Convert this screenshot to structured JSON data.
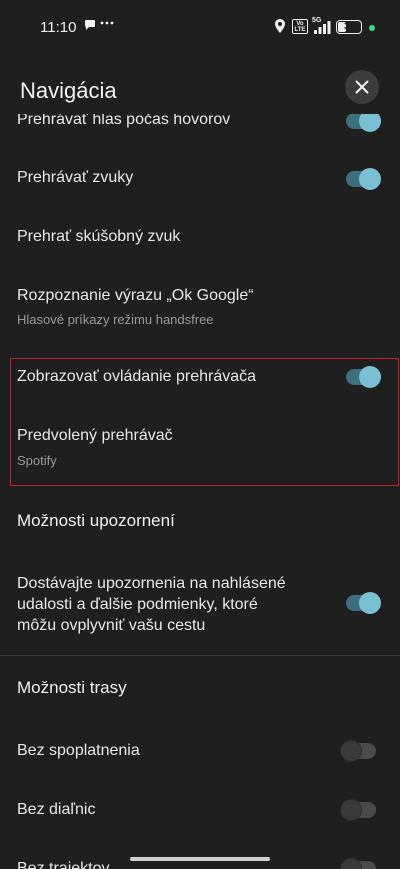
{
  "status_bar": {
    "time": "11:10",
    "volte_label": "Vo LTE",
    "network_label": "5G",
    "battery_level": "37",
    "icons": [
      "chat-bubble-icon",
      "more-dots-icon",
      "location-icon",
      "volte-icon",
      "signal-icon",
      "battery-icon",
      "camera-active-dot-icon"
    ]
  },
  "header": {
    "title": "Navigácia",
    "close_icon": "close-icon"
  },
  "settings": {
    "voice_during_calls": {
      "label": "Prehrávať hlas počas hovorov",
      "enabled": true
    },
    "play_sounds": {
      "label": "Prehrávať zvuky",
      "enabled": true
    },
    "test_sound": {
      "label": "Prehrať skúšobný zvuk"
    },
    "ok_google": {
      "label": "Rozpoznanie výrazu „Ok Google“",
      "sub": "Hlasové príkazy režimu handsfree"
    },
    "media_controls": {
      "label": "Zobrazovať ovládanie prehrávača",
      "enabled": true
    },
    "default_player": {
      "label": "Predvolený prehrávač",
      "sub": "Spotify"
    }
  },
  "notifications_section": {
    "title": "Možnosti upozornení",
    "reported_events": {
      "line1": "Dostávajte upozornenia na nahlásené",
      "line2": "udalosti a ďalšie podmienky, ktoré",
      "line3": "môžu ovplyvniť vašu cestu",
      "enabled": true
    }
  },
  "route_section": {
    "title": "Možnosti trasy",
    "avoid_tolls": {
      "label": "Bez spoplatnenia",
      "enabled": false
    },
    "avoid_highways": {
      "label": "Bez diaľnic",
      "enabled": false
    },
    "avoid_ferries": {
      "label": "Bez trajektov",
      "enabled": false
    }
  },
  "colors": {
    "background": "#1f1f1f",
    "toggle_on_track": "#3d6f7c",
    "toggle_on_knob": "#7ac0d4",
    "highlight_border": "#c0242a"
  }
}
